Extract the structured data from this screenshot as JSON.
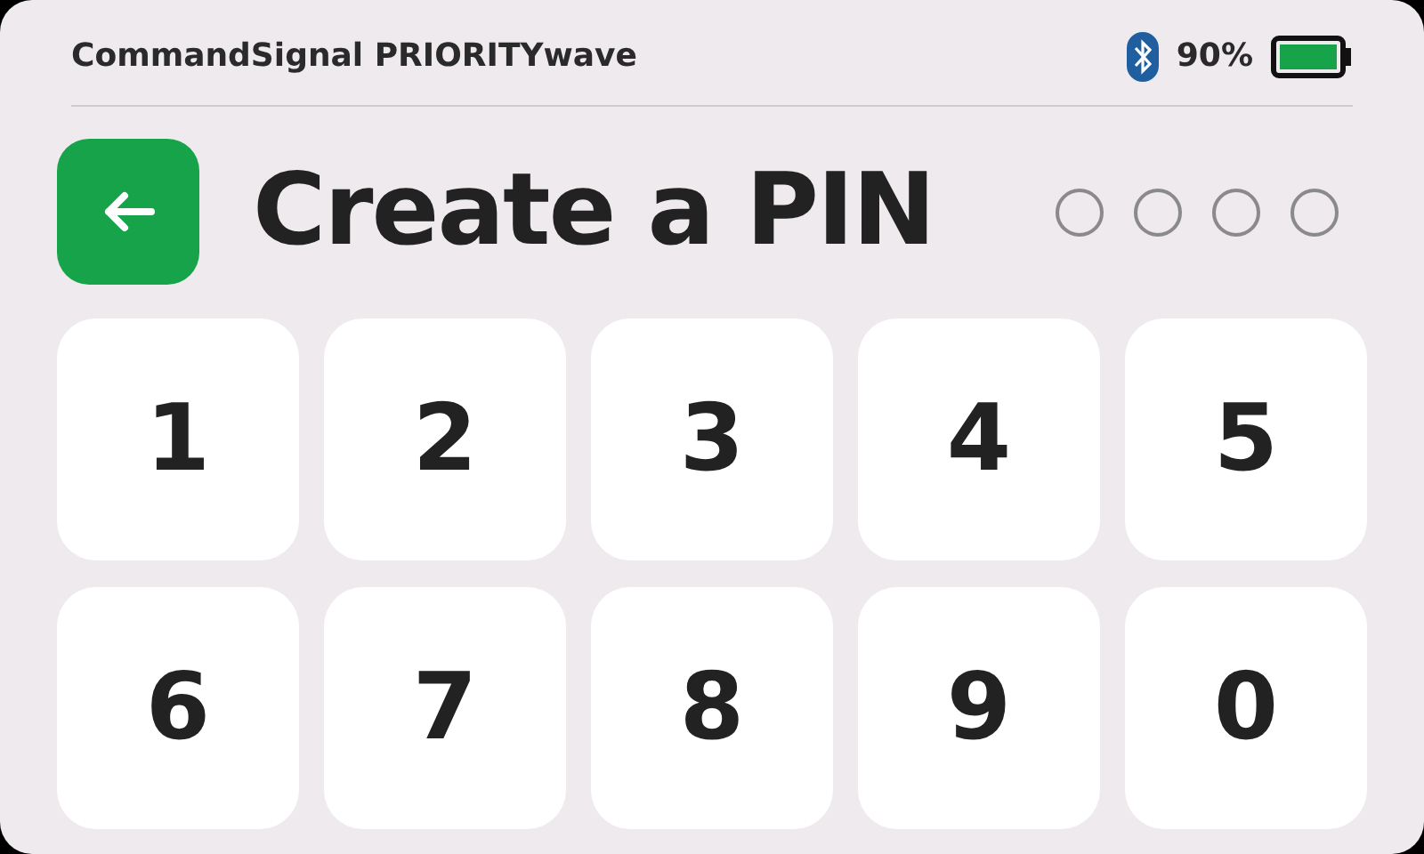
{
  "status_bar": {
    "device_name": "CommandSignal PRIORITYwave",
    "bluetooth": true,
    "battery": "90%"
  },
  "header": {
    "title": "Create a PIN"
  },
  "pin_dots": [
    {
      "filled": false
    },
    {
      "filled": false
    },
    {
      "filled": false
    },
    {
      "filled": false
    }
  ],
  "keypad": [
    "1",
    "2",
    "3",
    "4",
    "5",
    "6",
    "7",
    "8",
    "9",
    "0"
  ]
}
